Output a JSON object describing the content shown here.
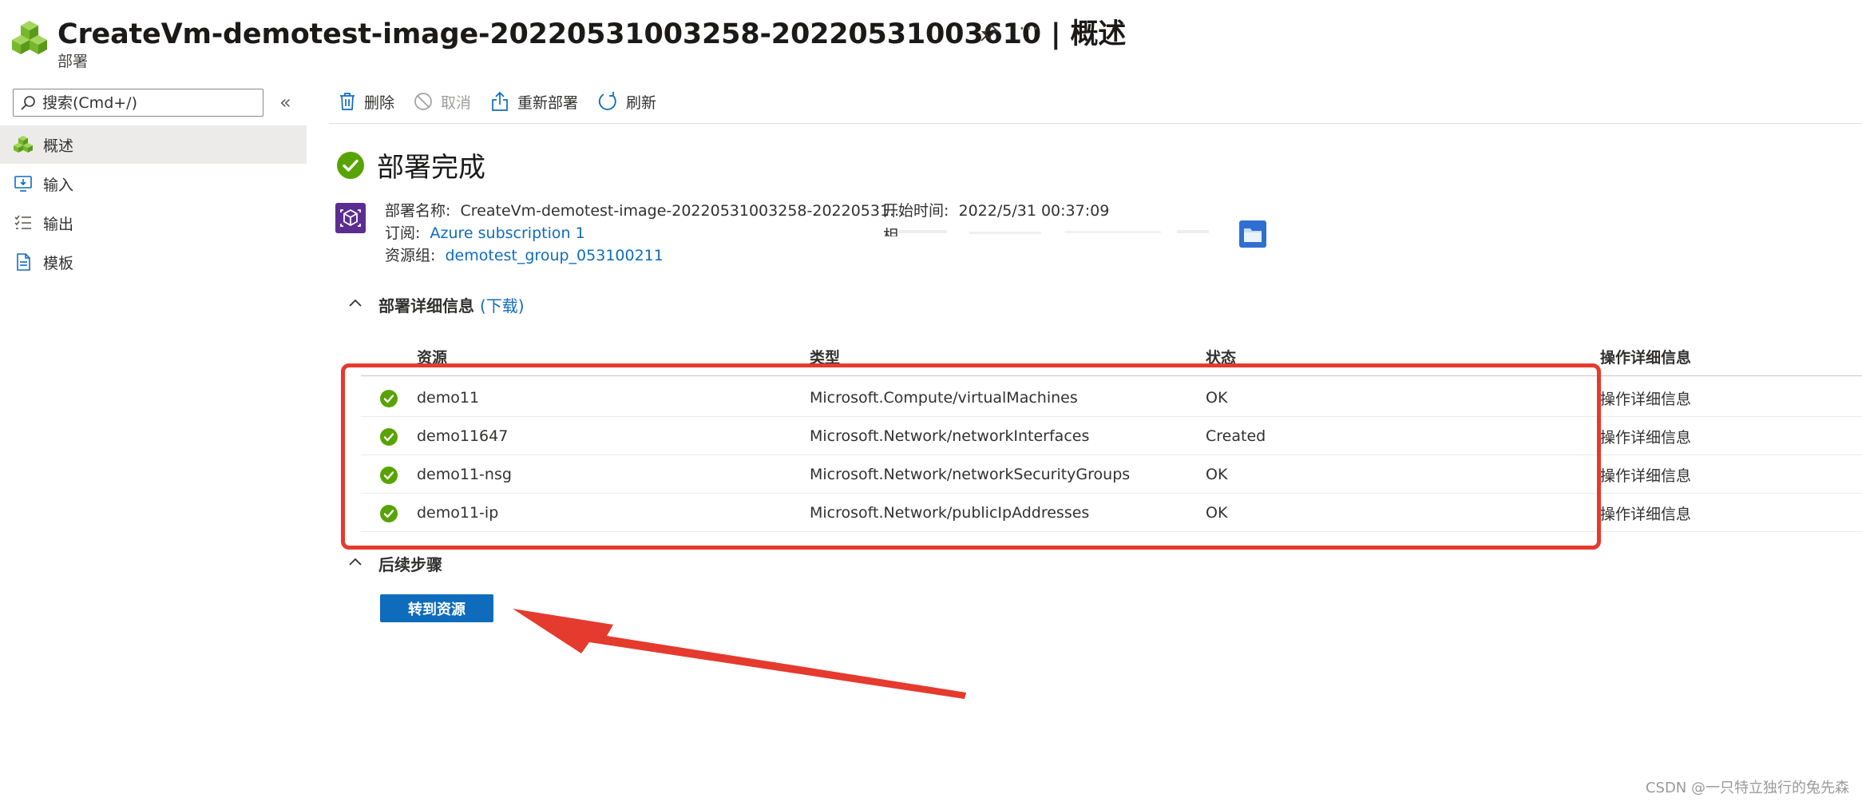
{
  "header": {
    "title": "CreateVm-demotest-image-20220531003258-20220531003610 | 概述",
    "subtitle": "部署",
    "more": "···"
  },
  "sidebar": {
    "search_placeholder": "搜索(Cmd+/)",
    "collapse": "«",
    "items": [
      {
        "label": "概述",
        "icon": "overview-icon",
        "active": true
      },
      {
        "label": "输入",
        "icon": "inputs-icon",
        "active": false
      },
      {
        "label": "输出",
        "icon": "outputs-icon",
        "active": false
      },
      {
        "label": "模板",
        "icon": "template-icon",
        "active": false
      }
    ]
  },
  "toolbar": {
    "delete": "删除",
    "cancel": "取消",
    "redeploy": "重新部署",
    "refresh": "刷新"
  },
  "status": {
    "title": "部署完成"
  },
  "essentials": {
    "deployment_name_label": "部署名称:",
    "deployment_name_value": "CreateVm-demotest-image-20220531003258-20220531...",
    "subscription_label": "订阅:",
    "subscription_value": "Azure subscription 1",
    "resource_group_label": "资源组:",
    "resource_group_value": "demotest_group_053100211",
    "start_time_label": "开始时间:",
    "start_time_value": "2022/5/31 00:37:09",
    "correlation_label": "相"
  },
  "details": {
    "title": "部署详细信息",
    "download": "(下载)",
    "columns": [
      "资源",
      "类型",
      "状态",
      "操作详细信息"
    ],
    "rows": [
      {
        "resource": "demo11",
        "type": "Microsoft.Compute/virtualMachines",
        "status": "OK",
        "details": "操作详细信息"
      },
      {
        "resource": "demo11647",
        "type": "Microsoft.Network/networkInterfaces",
        "status": "Created",
        "details": "操作详细信息"
      },
      {
        "resource": "demo11-nsg",
        "type": "Microsoft.Network/networkSecurityGroups",
        "status": "OK",
        "details": "操作详细信息"
      },
      {
        "resource": "demo11-ip",
        "type": "Microsoft.Network/publicIpAddresses",
        "status": "OK",
        "details": "操作详细信息"
      }
    ]
  },
  "next_steps": {
    "title": "后续步骤",
    "goto_button": "转到资源"
  },
  "watermark": "CSDN @一只特立独行的兔先森",
  "colors": {
    "accent": "#0f6cbd",
    "success": "#57a300",
    "annotation_red": "#e53a2e",
    "deploy_icon_bg": "#5c2d91"
  }
}
